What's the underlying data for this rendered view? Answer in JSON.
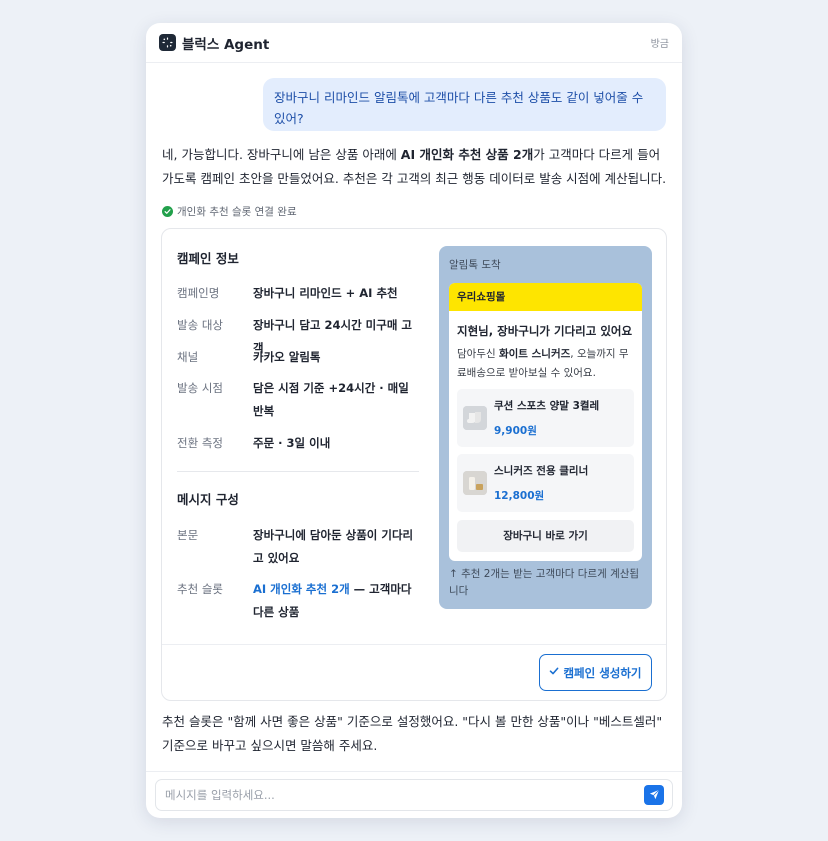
{
  "app": {
    "title": "블럭스 Agent",
    "time": "방금"
  },
  "user_message": "장바구니 리마인드 알림톡에 고객마다 다른 추천 상품도 같이 넣어줄 수 있어?",
  "reply": {
    "intro_1": "네, 가능합니다. 장바구니에 남은 상품 아래에 ",
    "intro_bold": "AI 개인화 추천 상품 2개",
    "intro_2": "가 고객마다 다르게 들어가도록 캠페인 초안을 만들었어요. 추천은 각 고객의 최근 행동 데이터로 발송 시점에 계산됩니다.",
    "status": "개인화 추천 슬롯 연결 완료",
    "outro": "추천 슬롯은 \"함께 사면 좋은 상품\" 기준으로 설정했어요. \"다시 볼 만한 상품\"이나 \"베스트셀러\" 기준으로 바꾸고 싶으시면 말씀해 주세요."
  },
  "campaign": {
    "info_title": "캠페인 정보",
    "rows": [
      {
        "label": "캠페인명",
        "value": "장바구니 리마인드 + AI 추천"
      },
      {
        "label": "발송 대상",
        "value": "장바구니 담고 24시간 미구매 고객"
      },
      {
        "label": "채널",
        "value": "카카오 알림톡"
      },
      {
        "label": "발송 시점",
        "value": "담은 시점 기준 +24시간 · 매일 반복"
      },
      {
        "label": "전환 측정",
        "value": "주문 · 3일 이내"
      }
    ],
    "message_title": "메시지 구성",
    "body_label": "본문",
    "body_value": "장바구니에 담아둔 상품이 기다리고 있어요",
    "slot_label": "추천 슬롯",
    "slot_link": "AI 개인화 추천 2개",
    "slot_rest": " — 고객마다 다른 상품",
    "create_button": "캠페인 생성하기"
  },
  "preview": {
    "label": "알림톡 도착",
    "shop_name": "우리쇼핑몰",
    "headline": "지현님, 장바구니가 기다리고 있어요",
    "body_1": "담아두신 ",
    "body_bold": "화이트 스니커즈",
    "body_2": ", 오늘까지 무료배송으로 받아보실 수 있어요.",
    "products": [
      {
        "name": "쿠션 스포츠 양말 3켤레",
        "price": "9,900원"
      },
      {
        "name": "스니커즈 전용 클리너",
        "price": "12,800원"
      }
    ],
    "cart_button": "장바구니 바로 가기",
    "note": "↑ 추천 2개는 받는 고객마다 다르게 계산됩니다"
  },
  "composer": {
    "placeholder": "메시지를 입력하세요..."
  },
  "colors": {
    "accent": "#1a6fd1",
    "kakao_yellow": "#fee500",
    "success": "#22a04b"
  }
}
